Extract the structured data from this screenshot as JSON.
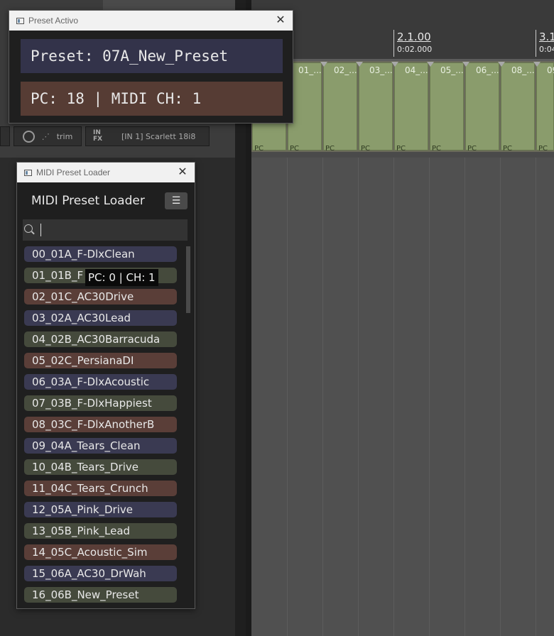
{
  "colors": {
    "list_blue": "#3a3a52",
    "list_green": "#454a3c",
    "list_red": "#5a3e38",
    "item_green": "#8a9c6c"
  },
  "preset_window": {
    "title": "Preset Activo",
    "preset_line": "Preset: 07A_New_Preset",
    "pc_line": "PC: 18 | MIDI CH: 1"
  },
  "daw": {
    "input_label": "[IN 1] Scarlett 18i8",
    "trim_label": "trim",
    "fx_label": "IN FX",
    "markers": [
      {
        "num": "2.1.00",
        "time": "0:02.000"
      },
      {
        "num": "3.1",
        "time": "0:04"
      }
    ],
    "items": [
      "01_...",
      "02_...",
      "03_...",
      "04_...",
      "05_...",
      "06_...",
      "08_...",
      "09"
    ],
    "item_pc_label": "PC"
  },
  "loader": {
    "window_title": "MIDI Preset Loader",
    "header": "MIDI Preset Loader",
    "menu_icon": "hamburger-icon",
    "search_value": "",
    "tooltip": "PC: 0 | CH: 1",
    "presets": [
      {
        "label": "00_01A_F-DlxClean",
        "color": "blue"
      },
      {
        "label": "01_01B_F",
        "color": "green"
      },
      {
        "label": "02_01C_AC30Drive",
        "color": "red"
      },
      {
        "label": "03_02A_AC30Lead",
        "color": "blue"
      },
      {
        "label": "04_02B_AC30Barracuda",
        "color": "green"
      },
      {
        "label": "05_02C_PersianaDI",
        "color": "red"
      },
      {
        "label": "06_03A_F-DlxAcoustic",
        "color": "blue"
      },
      {
        "label": "07_03B_F-DlxHappiest",
        "color": "green"
      },
      {
        "label": "08_03C_F-DlxAnotherB",
        "color": "red"
      },
      {
        "label": "09_04A_Tears_Clean",
        "color": "blue"
      },
      {
        "label": "10_04B_Tears_Drive",
        "color": "green"
      },
      {
        "label": "11_04C_Tears_Crunch",
        "color": "red"
      },
      {
        "label": "12_05A_Pink_Drive",
        "color": "blue"
      },
      {
        "label": "13_05B_Pink_Lead",
        "color": "green"
      },
      {
        "label": "14_05C_Acoustic_Sim",
        "color": "red"
      },
      {
        "label": "15_06A_AC30_DrWah",
        "color": "blue"
      },
      {
        "label": "16_06B_New_Preset",
        "color": "green"
      }
    ]
  }
}
